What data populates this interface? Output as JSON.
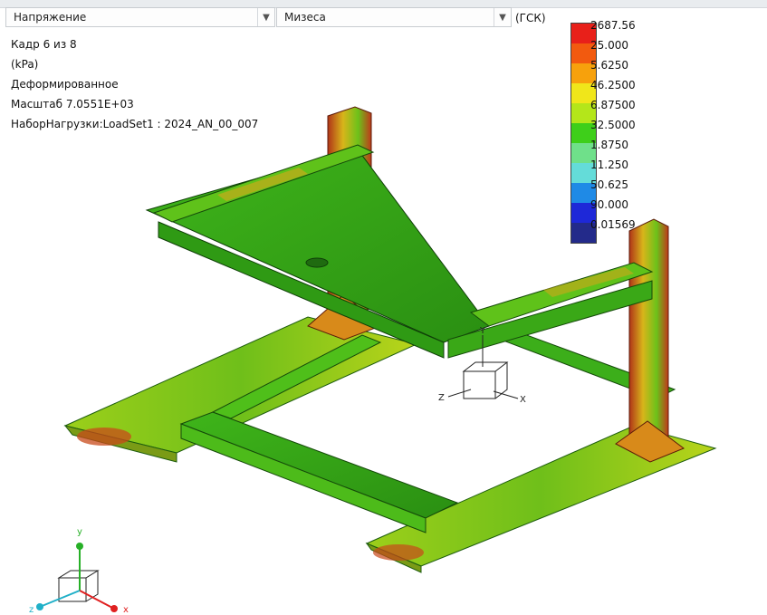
{
  "toolbar": {
    "result_dropdown": "Напряжение",
    "component_dropdown": "Мизеса",
    "csys": "(ГСК)"
  },
  "info": {
    "frame": "Кадр 6 из 8",
    "units": "(kPa)",
    "mode": "Деформированное",
    "scale": "Масштаб  7.0551E+03",
    "loadset": "НаборНагрузки:LoadSet1 :  2024_AN_00_007"
  },
  "legend": {
    "labels": [
      "2687.56",
      "25.000",
      "5.6250",
      "46.2500",
      "6.87500",
      "32.5000",
      "1.8750",
      "11.250",
      "50.625",
      "90.000",
      "0.01569"
    ],
    "colors": [
      "#e8201a",
      "#f25a0f",
      "#f7a10c",
      "#f0e61a",
      "#b4e61a",
      "#3ecf1a",
      "#6fe08a",
      "#64dcd9",
      "#1f8ae6",
      "#1e28d8",
      "#232a8a"
    ]
  },
  "model": {
    "csys_labels": {
      "x": "X",
      "y": "Y",
      "z": "Z"
    },
    "triad_labels": {
      "x": "x",
      "y": "y",
      "z": "z"
    }
  }
}
